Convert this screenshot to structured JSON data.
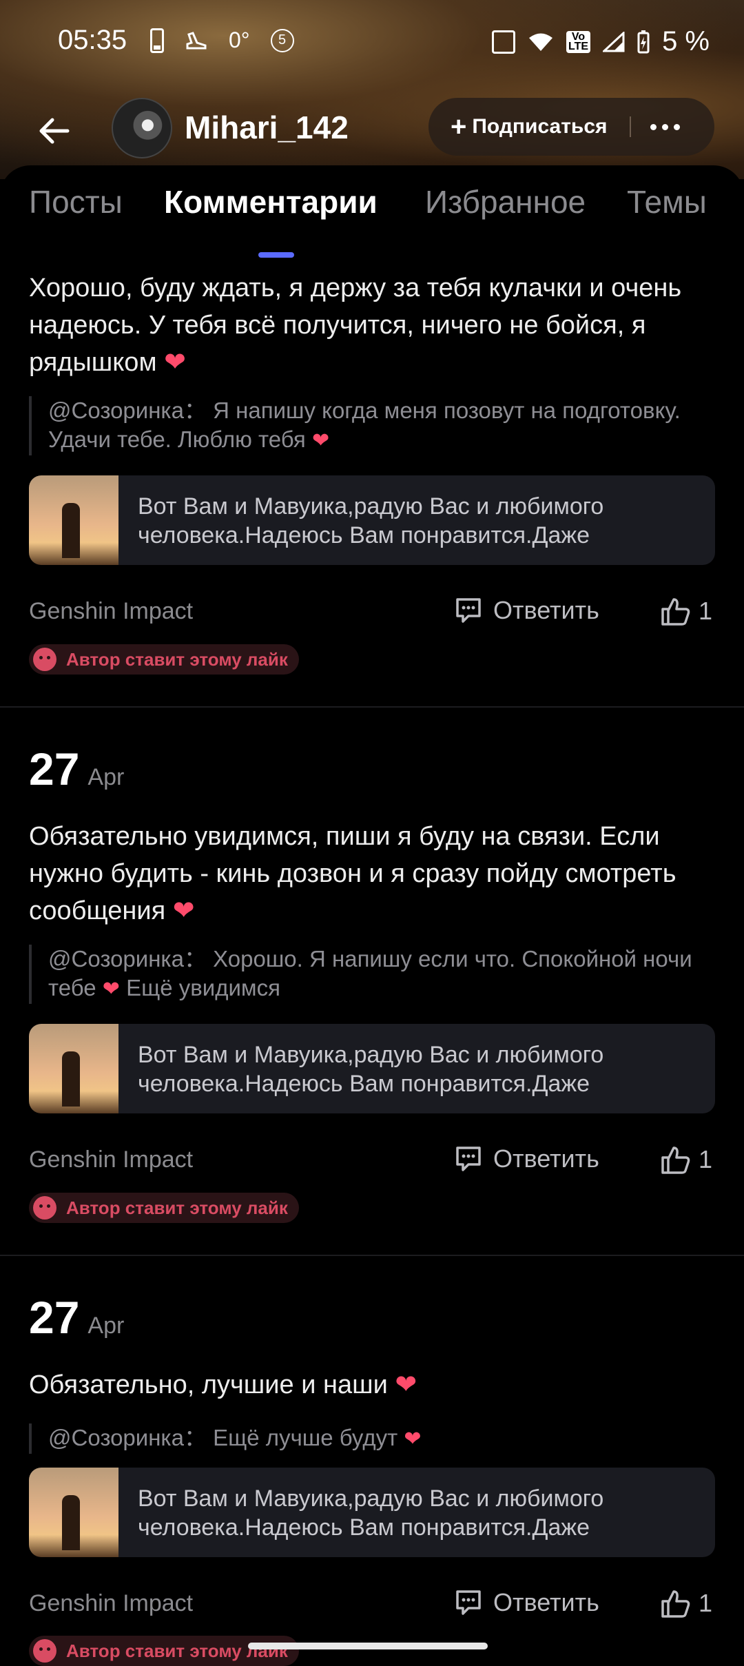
{
  "status_bar": {
    "time": "05:35",
    "temp": "0°",
    "badge": "5",
    "battery": "5 %"
  },
  "profile": {
    "username": "Mihari_142",
    "follow_label": "Подписаться"
  },
  "tabs": [
    "Посты",
    "Комментарии",
    "Избранное",
    "Темы"
  ],
  "active_tab": "Комментарии",
  "comments": [
    {
      "day": "",
      "month": "",
      "text": "Хорошо, буду ждать, я держу за тебя кулачки и очень надеюсь. У тебя всё получится, ничего не бойся, я рядышком",
      "quote_user": "@Созоринка：",
      "quote_text": "Я напишу когда меня позовут на подготовку. Удачи тебе. Люблю тебя",
      "post_text": "Вот Вам и Мавуика,радую Вас и любимого человека.Надеюсь Вам понравится.Даже",
      "game": "Genshin Impact",
      "reply_label": "Ответить",
      "likes": "1",
      "author_like": "Автор ставит этому лайк"
    },
    {
      "day": "27",
      "month": "Apr",
      "text": "Обязательно увидимся, пиши я буду на связи. Если нужно будить - кинь дозвон и я сразу пойду смотреть сообщения",
      "quote_user": "@Созоринка：",
      "quote_text": "Хорошо. Я напишу если что. Спокойной ночи тебе",
      "quote_tail": "Ещё увидимся",
      "post_text": "Вот Вам и Мавуика,радую Вас и любимого человека.Надеюсь Вам понравится.Даже",
      "game": "Genshin Impact",
      "reply_label": "Ответить",
      "likes": "1",
      "author_like": "Автор ставит этому лайк"
    },
    {
      "day": "27",
      "month": "Apr",
      "text": "Обязательно, лучшие и наши",
      "quote_user": "@Созоринка：",
      "quote_text": "Ещё лучше будут",
      "post_text": "Вот Вам и Мавуика,радую Вас и любимого человека.Надеюсь Вам понравится.Даже",
      "game": "Genshin Impact",
      "reply_label": "Ответить",
      "likes": "1",
      "author_like": "Автор ставит этому лайк"
    }
  ],
  "colors": {
    "accent": "#5b6bff",
    "heart": "#ff4b6b",
    "author_like": "#d94c63",
    "background": "#000000"
  }
}
